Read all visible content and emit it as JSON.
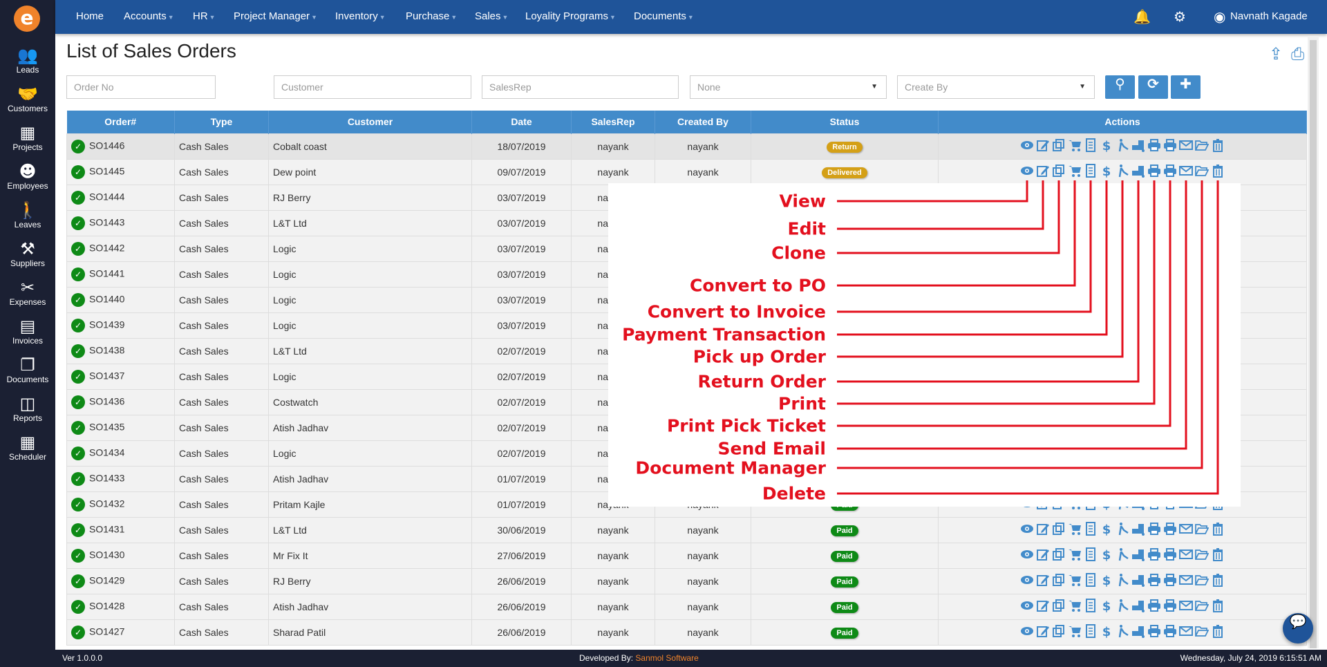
{
  "app": {
    "logo": "e"
  },
  "sidebar": {
    "items": [
      {
        "label": "Leads",
        "icon": "leads-icon",
        "glyph": "👥"
      },
      {
        "label": "Customers",
        "icon": "customers-icon",
        "glyph": "🤝"
      },
      {
        "label": "Projects",
        "icon": "projects-icon",
        "glyph": "▦"
      },
      {
        "label": "Employees",
        "icon": "employees-icon",
        "glyph": "☻"
      },
      {
        "label": "Leaves",
        "icon": "leaves-icon",
        "glyph": "🚶"
      },
      {
        "label": "Suppliers",
        "icon": "suppliers-icon",
        "glyph": "⚒"
      },
      {
        "label": "Expenses",
        "icon": "expenses-icon",
        "glyph": "✂"
      },
      {
        "label": "Invoices",
        "icon": "invoices-icon",
        "glyph": "▤"
      },
      {
        "label": "Documents",
        "icon": "documents-icon",
        "glyph": "❐"
      },
      {
        "label": "Reports",
        "icon": "reports-icon",
        "glyph": "◫"
      },
      {
        "label": "Scheduler",
        "icon": "calendar-icon",
        "glyph": "▦"
      }
    ]
  },
  "nav": {
    "items": [
      {
        "label": "Home",
        "dropdown": false
      },
      {
        "label": "Accounts",
        "dropdown": true
      },
      {
        "label": "HR",
        "dropdown": true
      },
      {
        "label": "Project Manager",
        "dropdown": true
      },
      {
        "label": "Inventory",
        "dropdown": true
      },
      {
        "label": "Purchase",
        "dropdown": true
      },
      {
        "label": "Sales",
        "dropdown": true
      },
      {
        "label": "Loyality Programs",
        "dropdown": true
      },
      {
        "label": "Documents",
        "dropdown": true
      }
    ],
    "user": "Navnath Kagade"
  },
  "page": {
    "title": "List of Sales Orders"
  },
  "filters": {
    "order_no": "Order No",
    "customer": "Customer",
    "salesrep": "SalesRep",
    "status_select": "None",
    "created_by_select": "Create By"
  },
  "table": {
    "headers": [
      "Order#",
      "Type",
      "Customer",
      "Date",
      "SalesRep",
      "Created By",
      "Status",
      "Actions"
    ],
    "rows": [
      [
        "SO1446",
        "Cash Sales",
        "Cobalt coast",
        "18/07/2019",
        "nayank",
        "nayank",
        "Return"
      ],
      [
        "SO1445",
        "Cash Sales",
        "Dew point",
        "09/07/2019",
        "nayank",
        "nayank",
        "Delivered"
      ],
      [
        "SO1444",
        "Cash Sales",
        "RJ Berry",
        "03/07/2019",
        "nayank",
        "",
        ""
      ],
      [
        "SO1443",
        "Cash Sales",
        "L&T Ltd",
        "03/07/2019",
        "nayank",
        "",
        ""
      ],
      [
        "SO1442",
        "Cash Sales",
        "Logic",
        "03/07/2019",
        "nayank",
        "",
        ""
      ],
      [
        "SO1441",
        "Cash Sales",
        "Logic",
        "03/07/2019",
        "nayank",
        "",
        ""
      ],
      [
        "SO1440",
        "Cash Sales",
        "Logic",
        "03/07/2019",
        "nayank",
        "",
        ""
      ],
      [
        "SO1439",
        "Cash Sales",
        "Logic",
        "03/07/2019",
        "nayank",
        "",
        ""
      ],
      [
        "SO1438",
        "Cash Sales",
        "L&T Ltd",
        "02/07/2019",
        "nayank",
        "",
        ""
      ],
      [
        "SO1437",
        "Cash Sales",
        "Logic",
        "02/07/2019",
        "nayank",
        "",
        ""
      ],
      [
        "SO1436",
        "Cash Sales",
        "Costwatch",
        "02/07/2019",
        "nayank",
        "",
        ""
      ],
      [
        "SO1435",
        "Cash Sales",
        "Atish Jadhav",
        "02/07/2019",
        "nayank",
        "",
        ""
      ],
      [
        "SO1434",
        "Cash Sales",
        "Logic",
        "02/07/2019",
        "nayank",
        "",
        ""
      ],
      [
        "SO1433",
        "Cash Sales",
        "Atish Jadhav",
        "01/07/2019",
        "nayank",
        "",
        ""
      ],
      [
        "SO1432",
        "Cash Sales",
        "Pritam Kajle",
        "01/07/2019",
        "nayank",
        "nayank",
        "Paid"
      ],
      [
        "SO1431",
        "Cash Sales",
        "L&T Ltd",
        "30/06/2019",
        "nayank",
        "nayank",
        "Paid"
      ],
      [
        "SO1430",
        "Cash Sales",
        "Mr Fix It",
        "27/06/2019",
        "nayank",
        "nayank",
        "Paid"
      ],
      [
        "SO1429",
        "Cash Sales",
        "RJ Berry",
        "26/06/2019",
        "nayank",
        "nayank",
        "Paid"
      ],
      [
        "SO1428",
        "Cash Sales",
        "Atish Jadhav",
        "26/06/2019",
        "nayank",
        "nayank",
        "Paid"
      ],
      [
        "SO1427",
        "Cash Sales",
        "Sharad Patil",
        "26/06/2019",
        "nayank",
        "nayank",
        "Paid"
      ]
    ],
    "status_colors": {
      "Return": "#d4a017",
      "Delivered": "#d4a017",
      "Paid": "#0e8a16"
    },
    "actions": [
      "view",
      "edit",
      "clone",
      "cart",
      "invoice",
      "dollar",
      "pickup",
      "return",
      "print",
      "print-ticket",
      "email",
      "folder",
      "delete"
    ]
  },
  "annotations": [
    "View",
    "Edit",
    "Clone",
    "Convert to PO",
    "Convert to Invoice",
    "Payment Transaction",
    "Pick up Order",
    "Return Order",
    "Print",
    "Print Pick Ticket",
    "Send Email",
    "Document Manager",
    "Delete"
  ],
  "footer": {
    "version": "Ver 1.0.0.0",
    "developed_label": "Developed By:",
    "developer": "Sanmol Software",
    "datetime": "Wednesday, July 24, 2019 6:15:51 AM"
  },
  "colors": {
    "nav": "#1f5499",
    "sidebar": "#1b2033",
    "accent": "#428bca",
    "annotation": "#e3101e",
    "developer": "#f0832b"
  }
}
